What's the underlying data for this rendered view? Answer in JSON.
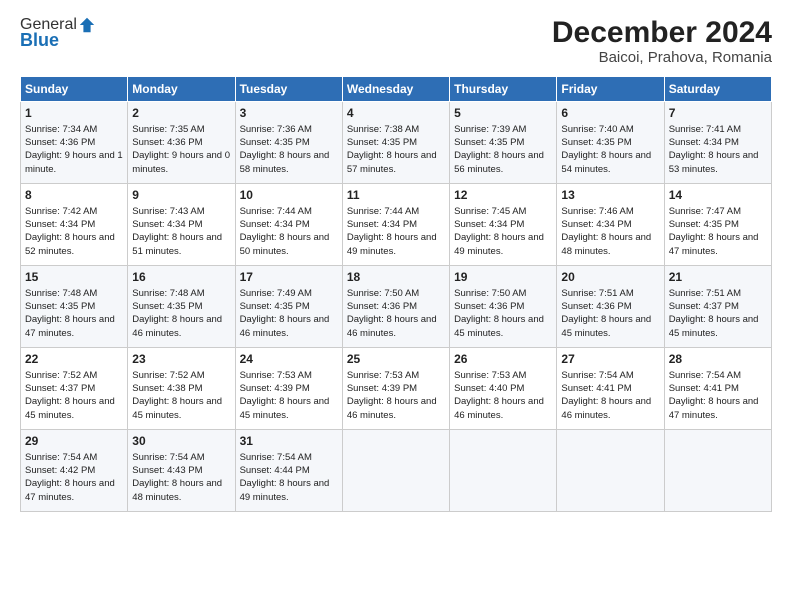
{
  "logo": {
    "general": "General",
    "blue": "Blue"
  },
  "title": "December 2024",
  "subtitle": "Baicoi, Prahova, Romania",
  "headers": [
    "Sunday",
    "Monday",
    "Tuesday",
    "Wednesday",
    "Thursday",
    "Friday",
    "Saturday"
  ],
  "weeks": [
    [
      {
        "day": "1",
        "sunrise": "7:34 AM",
        "sunset": "4:36 PM",
        "daylight": "9 hours and 1 minute."
      },
      {
        "day": "2",
        "sunrise": "7:35 AM",
        "sunset": "4:36 PM",
        "daylight": "9 hours and 0 minutes."
      },
      {
        "day": "3",
        "sunrise": "7:36 AM",
        "sunset": "4:35 PM",
        "daylight": "8 hours and 58 minutes."
      },
      {
        "day": "4",
        "sunrise": "7:38 AM",
        "sunset": "4:35 PM",
        "daylight": "8 hours and 57 minutes."
      },
      {
        "day": "5",
        "sunrise": "7:39 AM",
        "sunset": "4:35 PM",
        "daylight": "8 hours and 56 minutes."
      },
      {
        "day": "6",
        "sunrise": "7:40 AM",
        "sunset": "4:35 PM",
        "daylight": "8 hours and 54 minutes."
      },
      {
        "day": "7",
        "sunrise": "7:41 AM",
        "sunset": "4:34 PM",
        "daylight": "8 hours and 53 minutes."
      }
    ],
    [
      {
        "day": "8",
        "sunrise": "7:42 AM",
        "sunset": "4:34 PM",
        "daylight": "8 hours and 52 minutes."
      },
      {
        "day": "9",
        "sunrise": "7:43 AM",
        "sunset": "4:34 PM",
        "daylight": "8 hours and 51 minutes."
      },
      {
        "day": "10",
        "sunrise": "7:44 AM",
        "sunset": "4:34 PM",
        "daylight": "8 hours and 50 minutes."
      },
      {
        "day": "11",
        "sunrise": "7:44 AM",
        "sunset": "4:34 PM",
        "daylight": "8 hours and 49 minutes."
      },
      {
        "day": "12",
        "sunrise": "7:45 AM",
        "sunset": "4:34 PM",
        "daylight": "8 hours and 49 minutes."
      },
      {
        "day": "13",
        "sunrise": "7:46 AM",
        "sunset": "4:34 PM",
        "daylight": "8 hours and 48 minutes."
      },
      {
        "day": "14",
        "sunrise": "7:47 AM",
        "sunset": "4:35 PM",
        "daylight": "8 hours and 47 minutes."
      }
    ],
    [
      {
        "day": "15",
        "sunrise": "7:48 AM",
        "sunset": "4:35 PM",
        "daylight": "8 hours and 47 minutes."
      },
      {
        "day": "16",
        "sunrise": "7:48 AM",
        "sunset": "4:35 PM",
        "daylight": "8 hours and 46 minutes."
      },
      {
        "day": "17",
        "sunrise": "7:49 AM",
        "sunset": "4:35 PM",
        "daylight": "8 hours and 46 minutes."
      },
      {
        "day": "18",
        "sunrise": "7:50 AM",
        "sunset": "4:36 PM",
        "daylight": "8 hours and 46 minutes."
      },
      {
        "day": "19",
        "sunrise": "7:50 AM",
        "sunset": "4:36 PM",
        "daylight": "8 hours and 45 minutes."
      },
      {
        "day": "20",
        "sunrise": "7:51 AM",
        "sunset": "4:36 PM",
        "daylight": "8 hours and 45 minutes."
      },
      {
        "day": "21",
        "sunrise": "7:51 AM",
        "sunset": "4:37 PM",
        "daylight": "8 hours and 45 minutes."
      }
    ],
    [
      {
        "day": "22",
        "sunrise": "7:52 AM",
        "sunset": "4:37 PM",
        "daylight": "8 hours and 45 minutes."
      },
      {
        "day": "23",
        "sunrise": "7:52 AM",
        "sunset": "4:38 PM",
        "daylight": "8 hours and 45 minutes."
      },
      {
        "day": "24",
        "sunrise": "7:53 AM",
        "sunset": "4:39 PM",
        "daylight": "8 hours and 45 minutes."
      },
      {
        "day": "25",
        "sunrise": "7:53 AM",
        "sunset": "4:39 PM",
        "daylight": "8 hours and 46 minutes."
      },
      {
        "day": "26",
        "sunrise": "7:53 AM",
        "sunset": "4:40 PM",
        "daylight": "8 hours and 46 minutes."
      },
      {
        "day": "27",
        "sunrise": "7:54 AM",
        "sunset": "4:41 PM",
        "daylight": "8 hours and 46 minutes."
      },
      {
        "day": "28",
        "sunrise": "7:54 AM",
        "sunset": "4:41 PM",
        "daylight": "8 hours and 47 minutes."
      }
    ],
    [
      {
        "day": "29",
        "sunrise": "7:54 AM",
        "sunset": "4:42 PM",
        "daylight": "8 hours and 47 minutes."
      },
      {
        "day": "30",
        "sunrise": "7:54 AM",
        "sunset": "4:43 PM",
        "daylight": "8 hours and 48 minutes."
      },
      {
        "day": "31",
        "sunrise": "7:54 AM",
        "sunset": "4:44 PM",
        "daylight": "8 hours and 49 minutes."
      },
      null,
      null,
      null,
      null
    ]
  ]
}
